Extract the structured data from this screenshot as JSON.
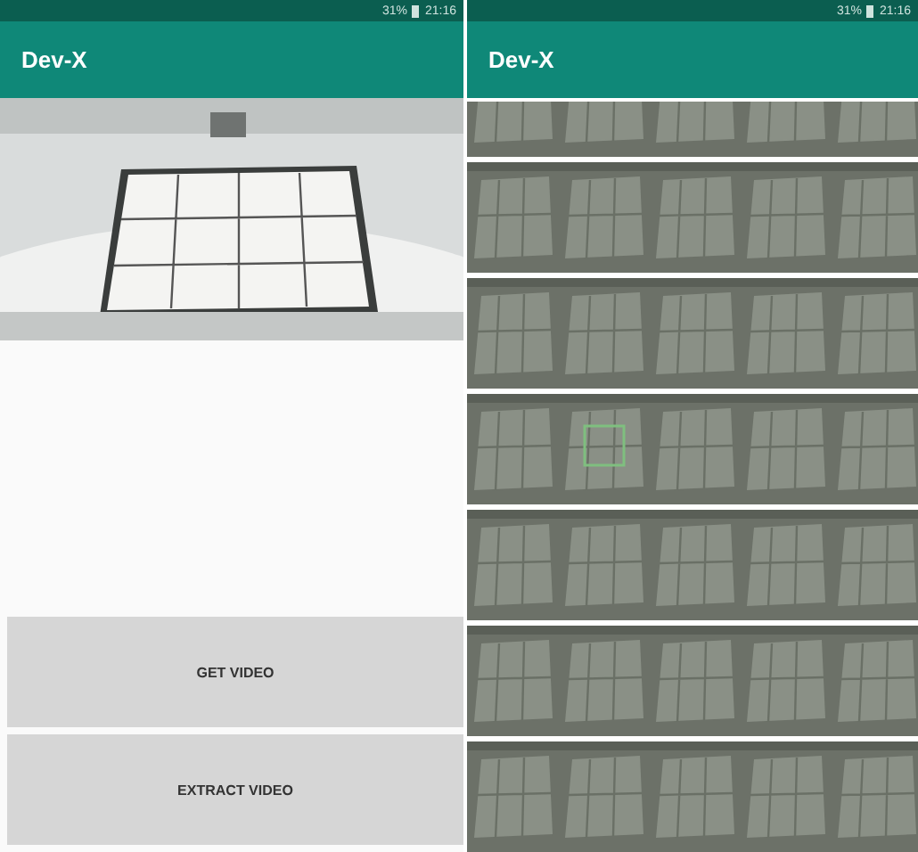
{
  "screens": [
    {
      "status_bar": {
        "battery": "31%",
        "time": "21:16"
      },
      "app_bar": {
        "title": "Dev-X"
      },
      "kind": "camera",
      "buttons": [
        "GET VIDEO",
        "EXTRACT VIDEO"
      ]
    },
    {
      "status_bar": {
        "battery": "31%",
        "time": "21:16"
      },
      "app_bar": {
        "title": "Dev-X"
      },
      "kind": "frames"
    }
  ]
}
